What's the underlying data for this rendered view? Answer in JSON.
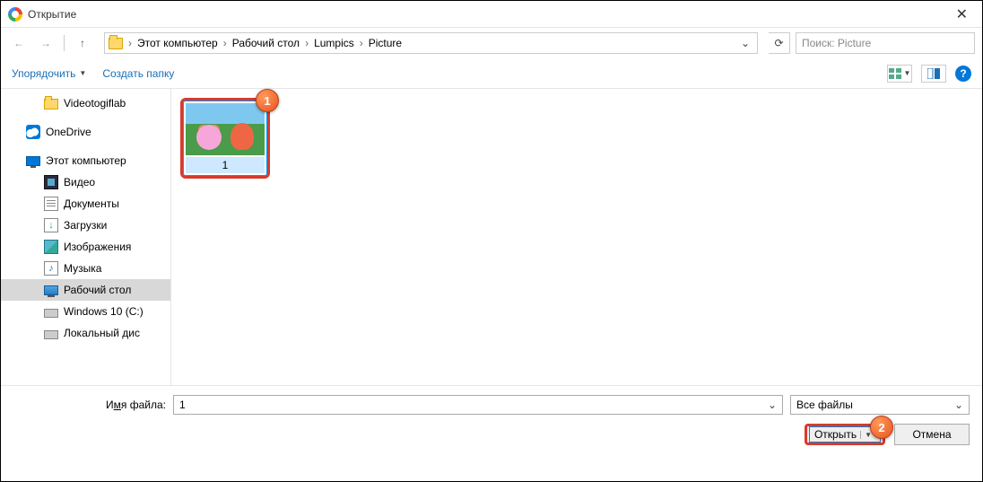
{
  "titlebar": {
    "title": "Открытие"
  },
  "breadcrumb": {
    "items": [
      "Этот компьютер",
      "Рабочий стол",
      "Lumpics",
      "Picture"
    ]
  },
  "search": {
    "placeholder": "Поиск: Picture"
  },
  "toolbar": {
    "organize": "Упорядочить",
    "newfolder": "Создать папку"
  },
  "sidebar": {
    "items": [
      {
        "label": "Videotogiflab",
        "icon": "folder",
        "child": true
      },
      {
        "label": "OneDrive",
        "icon": "cloud",
        "child": false
      },
      {
        "label": "Этот компьютер",
        "icon": "pc",
        "child": false
      },
      {
        "label": "Видео",
        "icon": "video",
        "child": true
      },
      {
        "label": "Документы",
        "icon": "doc",
        "child": true
      },
      {
        "label": "Загрузки",
        "icon": "download",
        "child": true
      },
      {
        "label": "Изображения",
        "icon": "image",
        "child": true
      },
      {
        "label": "Музыка",
        "icon": "music",
        "child": true
      },
      {
        "label": "Рабочий стол",
        "icon": "desktop",
        "child": true,
        "selected": true
      },
      {
        "label": "Windows 10 (C:)",
        "icon": "drive",
        "child": true
      },
      {
        "label": "Локальный дис",
        "icon": "drive",
        "child": true
      }
    ]
  },
  "content": {
    "file": {
      "name": "1"
    }
  },
  "footer": {
    "filename_label_pre": "И",
    "filename_label_u": "м",
    "filename_label_post": "я файла:",
    "filename_value": "1",
    "filter": "Все файлы",
    "open": "Открыть",
    "cancel": "Отмена"
  },
  "callouts": {
    "one": "1",
    "two": "2"
  }
}
